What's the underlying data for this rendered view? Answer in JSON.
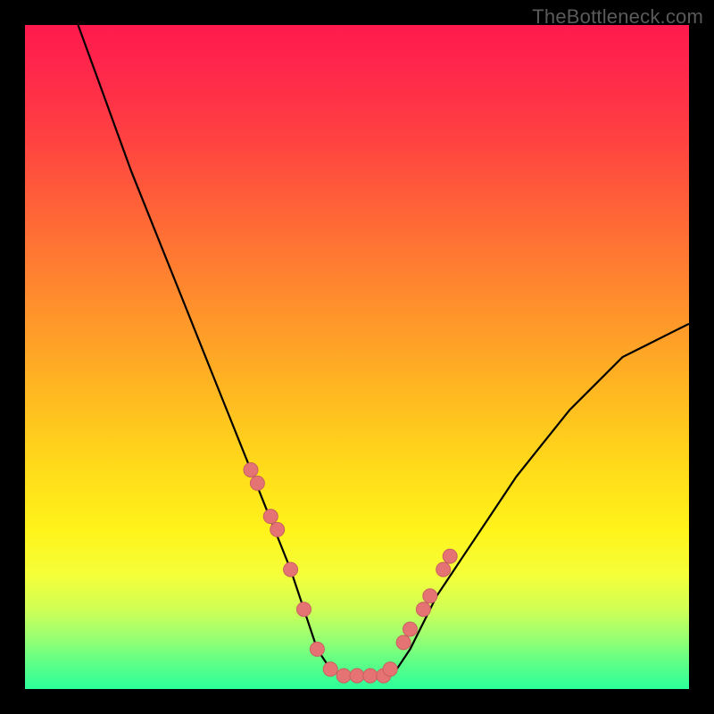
{
  "watermark": "TheBottleneck.com",
  "colors": {
    "curve": "#000000",
    "point_fill": "#e57373",
    "point_stroke": "#c96060",
    "gradient_top": "#ff1a4d",
    "gradient_bottom": "#2cff9a",
    "frame": "#000000"
  },
  "chart_data": {
    "type": "line",
    "title": "",
    "xlabel": "",
    "ylabel": "",
    "xlim": [
      0,
      100
    ],
    "ylim": [
      0,
      100
    ],
    "grid": false,
    "legend": false,
    "description": "Bottleneck curve — an asymmetric V. y ≈ 100 is worst (red), y ≈ 0 is ideal (green). The curve starts near (8,100), drops to a flat floor around y≈2 over roughly x=44..56, then rises again toward (100,55). Salmon dots mark sampled points clustered around the floor and lower flanks.",
    "series": [
      {
        "name": "bottleneck-curve",
        "kind": "line",
        "x": [
          8,
          12,
          16,
          20,
          24,
          28,
          30,
          32,
          34,
          36,
          38,
          40,
          42,
          44,
          46,
          48,
          50,
          52,
          54,
          56,
          58,
          60,
          62,
          66,
          70,
          74,
          78,
          82,
          86,
          90,
          94,
          98,
          100
        ],
        "y": [
          100,
          89,
          78,
          68,
          58,
          48,
          43,
          38,
          33,
          28,
          23,
          18,
          12,
          6,
          3,
          2,
          2,
          2,
          2,
          3,
          6,
          10,
          14,
          20,
          26,
          32,
          37,
          42,
          46,
          50,
          52,
          54,
          55
        ]
      },
      {
        "name": "sample-points",
        "kind": "scatter",
        "x": [
          34,
          35,
          37,
          38,
          40,
          42,
          44,
          46,
          48,
          50,
          52,
          54,
          55,
          57,
          58,
          60,
          61,
          63,
          64
        ],
        "y": [
          33,
          31,
          26,
          24,
          18,
          12,
          6,
          3,
          2,
          2,
          2,
          2,
          3,
          7,
          9,
          12,
          14,
          18,
          20
        ]
      }
    ]
  }
}
